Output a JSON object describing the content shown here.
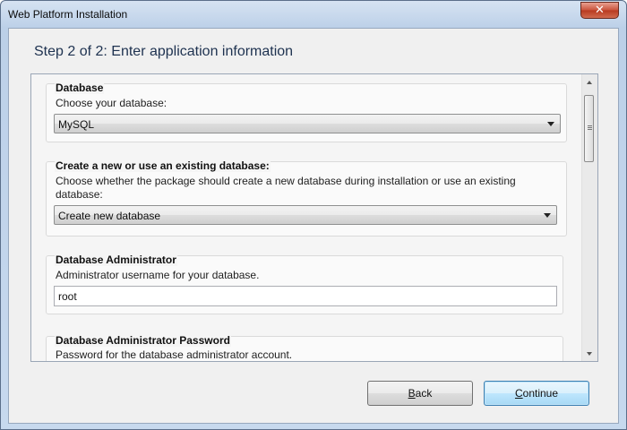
{
  "window": {
    "title": "Web Platform Installation",
    "close_glyph": "✕"
  },
  "header": {
    "step_title": "Step 2 of 2: Enter application information"
  },
  "sections": {
    "database": {
      "heading": "Database",
      "description": "Choose your database:",
      "selected": "MySQL"
    },
    "create": {
      "heading": "Create a new or use an existing database:",
      "description_line1": "Choose whether the package should create a new database during installation or use an existing",
      "description_line2": "database:",
      "selected": "Create new database"
    },
    "admin": {
      "heading": "Database Administrator",
      "description": "Administrator username for your database.",
      "value": "root"
    },
    "password": {
      "heading": "Database Administrator Password",
      "description": "Password for the database administrator account."
    }
  },
  "buttons": {
    "back_prefix": "B",
    "back_rest": "ack",
    "continue_prefix": "C",
    "continue_rest": "ontinue"
  },
  "icons": {
    "dropdown": "chevron-down-icon",
    "close": "close-icon"
  },
  "colors": {
    "title_bar": "#bcd0e8",
    "close_button": "#c9523b",
    "primary_button": "#bee6fd"
  }
}
